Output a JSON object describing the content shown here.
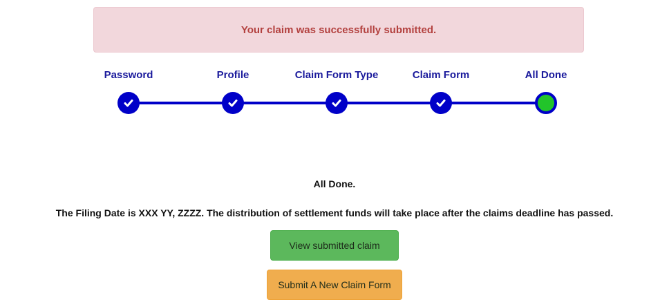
{
  "alert": {
    "message": "Your claim was successfully submitted."
  },
  "progress": {
    "steps": [
      {
        "label": "Password",
        "state": "complete"
      },
      {
        "label": "Profile",
        "state": "complete"
      },
      {
        "label": "Claim Form Type",
        "state": "complete"
      },
      {
        "label": "Claim Form",
        "state": "complete"
      },
      {
        "label": "All Done",
        "state": "current"
      }
    ],
    "colors": {
      "line": "#0000c8",
      "complete": "#0000c8",
      "current": "#22c42a",
      "label": "#1a1a9c"
    }
  },
  "main": {
    "title": "All Done.",
    "filing_text": "The Filing Date is XXX YY, ZZZZ. The distribution of settlement funds will take place after the claims deadline has passed.",
    "view_button": "View submitted claim",
    "new_button": "Submit A New Claim Form"
  },
  "colors": {
    "alert_bg": "#f2d7dc",
    "alert_text": "#b3413f",
    "view_button": "#5cb85c",
    "new_button": "#f0ad4e"
  }
}
